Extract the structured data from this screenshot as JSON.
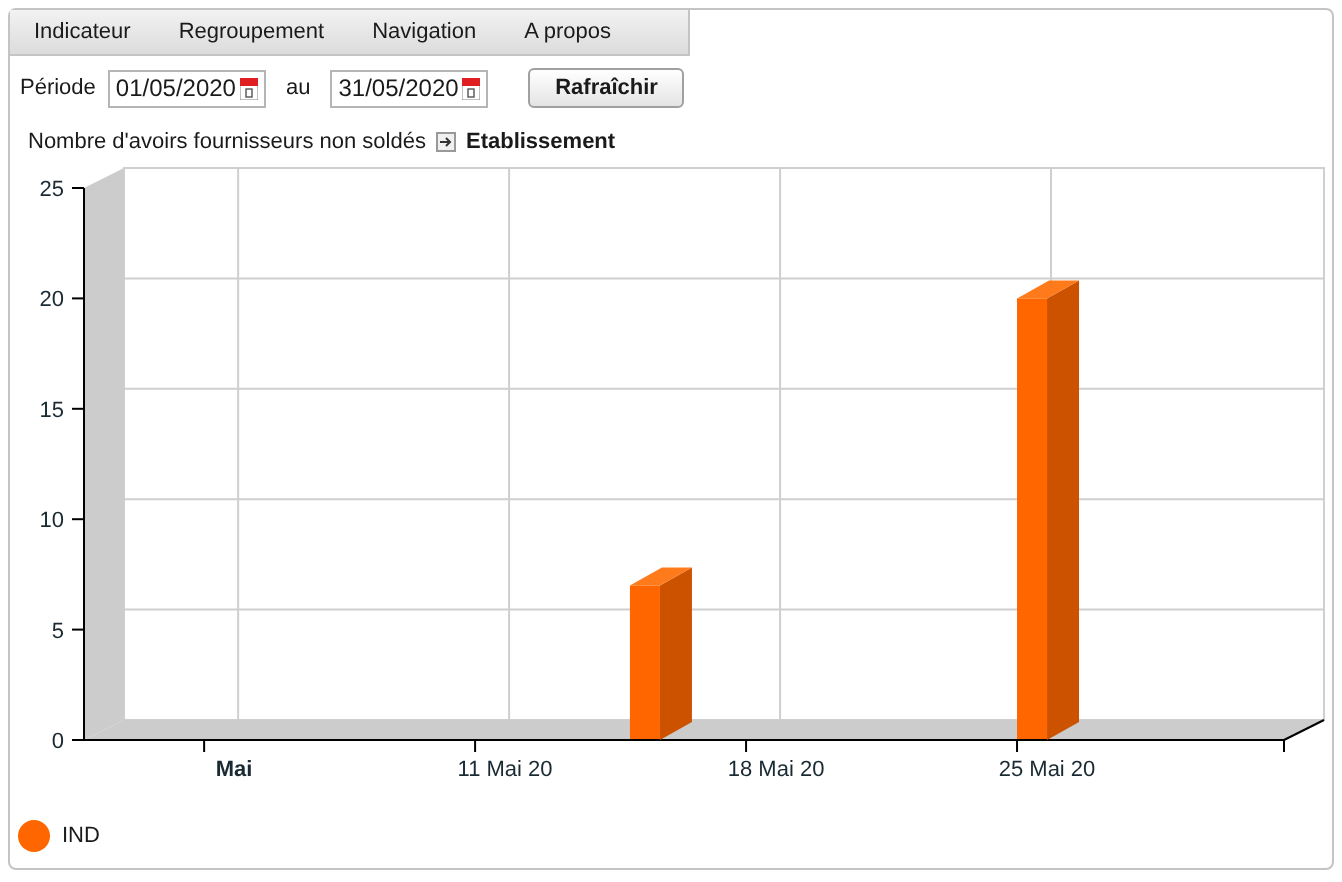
{
  "menu": [
    "Indicateur",
    "Regroupement",
    "Navigation",
    "A propos"
  ],
  "period": {
    "label": "Période",
    "from": "01/05/2020",
    "to_label": "au",
    "to": "31/05/2020",
    "refresh_button": "Rafraîchir"
  },
  "chart_title": {
    "text": "Nombre d'avoirs fournisseurs non soldés",
    "link": "Etablissement"
  },
  "chart_data": {
    "type": "bar",
    "categories": [
      null,
      null,
      null,
      "Mai",
      null,
      null,
      null,
      null,
      null,
      null,
      "11 Mai 20",
      null,
      null,
      null,
      null,
      null,
      null,
      "18 Mai 20",
      null,
      null,
      null,
      null,
      null,
      null,
      "25 Mai 20",
      null,
      null,
      null,
      null,
      null,
      null
    ],
    "series": [
      {
        "name": "IND",
        "color": "#ff6600",
        "values": [
          null,
          null,
          null,
          null,
          null,
          null,
          null,
          null,
          null,
          null,
          null,
          null,
          null,
          null,
          7,
          null,
          null,
          null,
          null,
          null,
          null,
          null,
          null,
          null,
          20,
          null,
          null,
          null,
          null,
          null,
          null
        ]
      }
    ],
    "ylim": [
      0,
      25
    ],
    "yticks": [
      0,
      5,
      10,
      15,
      20,
      25
    ],
    "grid": true
  }
}
